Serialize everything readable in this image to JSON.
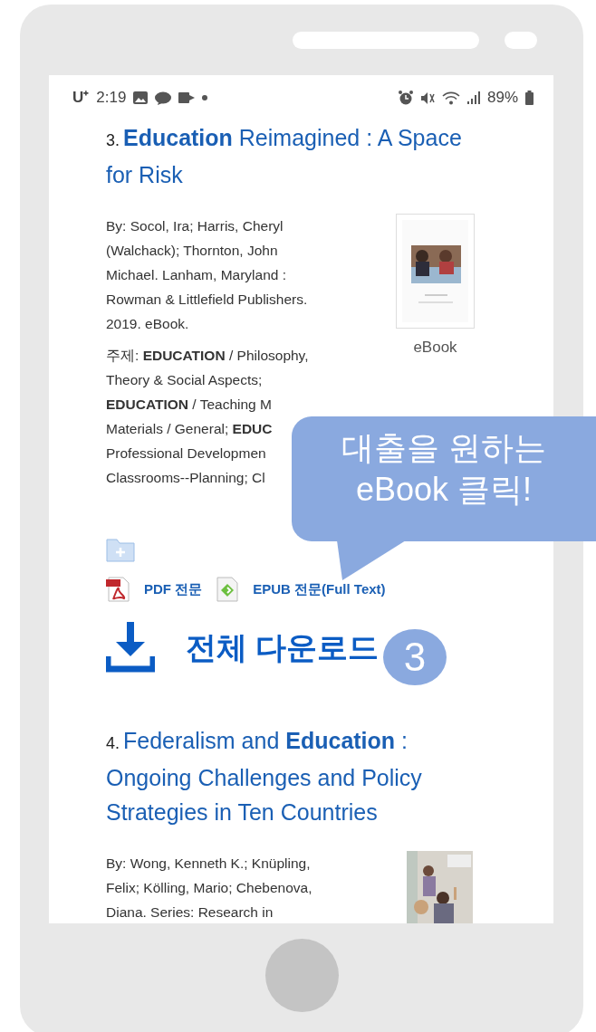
{
  "status_bar": {
    "carrier": "U⁺",
    "time": "2:19",
    "battery": "89%"
  },
  "results": [
    {
      "number": "3.",
      "title": "**Education** Reimagined : A Space for Risk",
      "byline": "By: Socol, Ira; Harris, Cheryl (Walchack); Thornton, John Michael. Lanham, Maryland : Rowman & Littlefield Publishers. 2019. eBook.",
      "cover_label": "eBook",
      "subject_lines": [
        "주제: **EDUCATION** / Philosophy,",
        "Theory & Social Aspects;",
        "**EDUCATION** / Teaching M",
        "Materials / General; **EDUC**",
        "Professional Developmen",
        "Classrooms--Planning; Cl"
      ],
      "links": [
        {
          "kind": "pdf",
          "label": "PDF 전문"
        },
        {
          "kind": "epub",
          "label": "EPUB 전문(Full Text)"
        }
      ],
      "download": "전체 다운로드"
    },
    {
      "number": "4.",
      "title": "Federalism and **Education** : Ongoing Challenges and Policy Strategies in Ten Countries",
      "byline": "By: Wong, Kenneth K.; Knüpling, Felix; Kölling, Mario; Chebenova, Diana. Series: Research in"
    }
  ],
  "callout": {
    "lines": [
      "대출을 원하는",
      "eBook 클릭!"
    ]
  },
  "step_badge": "3"
}
